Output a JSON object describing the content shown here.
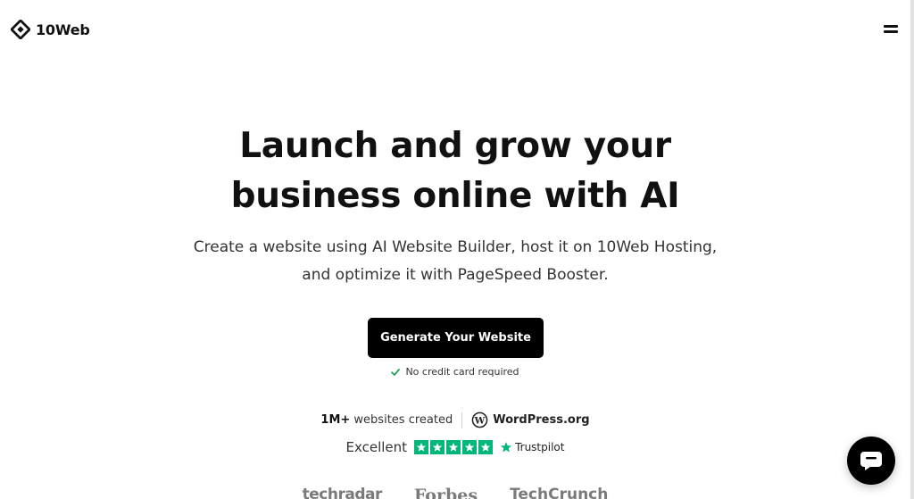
{
  "header": {
    "logo_text": "10Web",
    "logo_icon": "10web-diamond-icon",
    "menu_icon": "hamburger-menu-icon"
  },
  "hero": {
    "title_line1": "Launch and grow your",
    "title_line2": "business online with AI",
    "subtitle_line1": "Create a website using AI Website Builder, host it on 10Web Hosting,",
    "subtitle_line2": "and optimize it with PageSpeed Booster.",
    "cta_label": "Generate Your Website",
    "no_card_text": "No credit card required"
  },
  "stats": {
    "websites_count": "1M+",
    "websites_label": " websites created",
    "wordpress_label": "WordPress.org"
  },
  "rating": {
    "label": "Excellent",
    "stars": 5,
    "provider": "Trustpilot"
  },
  "press": [
    "techradar",
    "Forbes",
    "TechCrunch"
  ],
  "chat": {
    "icon": "chat-bubble-icon"
  },
  "colors": {
    "primary": "#000000",
    "trustpilot_green": "#00b67a",
    "check_green": "#22a45d"
  }
}
